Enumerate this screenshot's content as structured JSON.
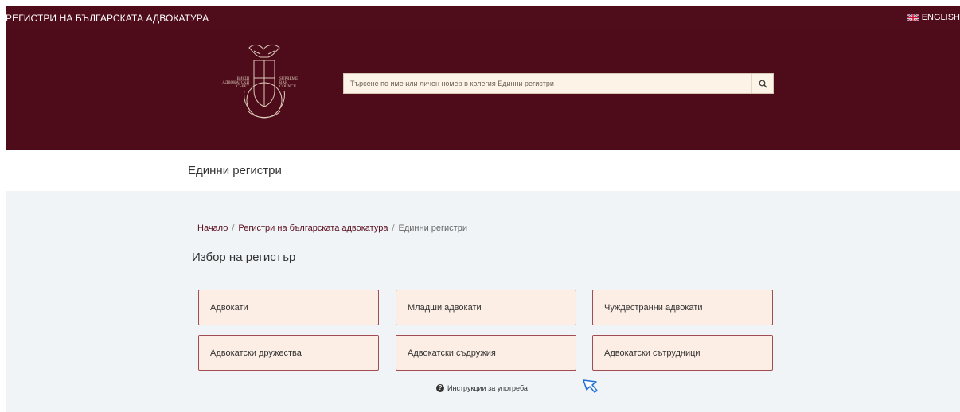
{
  "header": {
    "site_title": "РЕГИСТРИ НА БЪЛГАРСКАТА АДВОКАТУРА",
    "language": "ENGLISH",
    "logo": {
      "left_text": [
        "ВИСШ",
        "АДВОКАТСКИ",
        "СЪВЕТ"
      ],
      "right_text": [
        "SUPREME",
        "BAR",
        "COUNCIL"
      ]
    },
    "search_placeholder": "Търсене по име или личен номер в колегия Единни регистри"
  },
  "page_heading": "Единни регистри",
  "breadcrumb": {
    "home": "Начало",
    "registers": "Регистри на българската адвокатура",
    "current": "Единни регистри"
  },
  "section_title": "Избор на регистър",
  "registers": [
    "Адвокати",
    "Младши адвокати",
    "Чуждестранни адвокати",
    "Адвокатски дружества",
    "Адвокатски съдружия",
    "Адвокатски сътрудници"
  ],
  "help_link": "Инструкции за употреба",
  "colors": {
    "header_bg": "#4e0b19",
    "button_bg": "#fdeee5",
    "button_border": "#a34b52",
    "content_bg": "#f0f4f7"
  }
}
